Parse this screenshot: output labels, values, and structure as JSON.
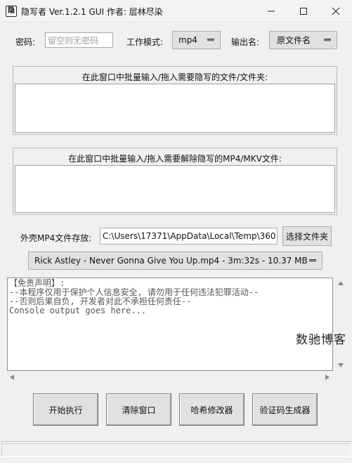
{
  "window": {
    "title": "隐写者 Ver.1.2.1 GUI 作者: 层林尽染",
    "app_icon_glyph": "隐",
    "controls": [
      "minimize-icon",
      "maximize-icon",
      "close-icon"
    ]
  },
  "settings": {
    "password_label": "密码:",
    "password_placeholder": "留空则无密码",
    "mode_label": "工作模式:",
    "mode_value": "mp4",
    "output_label": "输出名:",
    "output_value": "原文件名"
  },
  "dropzones": {
    "hide_label": "在此窗口中批量输入/拖入需要隐写的文件/文件夹:",
    "reveal_label": "在此窗口中批量输入/拖入需要解除隐写的MP4/MKV文件:"
  },
  "cover": {
    "label": "外壳MP4文件存放:",
    "path_value": "C:\\Users\\17371\\AppData\\Local\\Temp\\360",
    "choose_button": "选择文件夹",
    "selected_file": "Rick Astley - Never Gonna Give You Up.mp4 - 3m:32s - 10.37 MB"
  },
  "console": {
    "lines": [
      "【免责声明】:",
      "--本程序仅用于保护个人信息安全, 请勿用于任何违法犯罪活动--",
      "--否则后果自负, 开发者对此不承担任何责任--",
      "Console output goes here..."
    ]
  },
  "watermark": "数驰博客",
  "actions": {
    "start": "开始执行",
    "clear": "清除窗口",
    "hash": "哈希修改器",
    "captcha": "验证码生成器"
  },
  "colors": {
    "window_bg": "#f0f0f0",
    "button_bg": "#e1e1e1",
    "placeholder": "#a0a0a0"
  }
}
